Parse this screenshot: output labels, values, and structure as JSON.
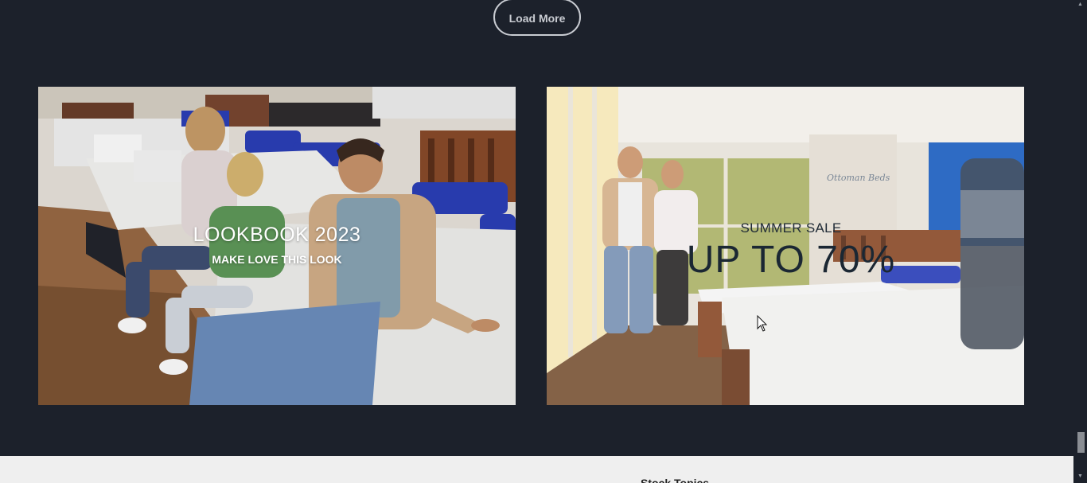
{
  "load_more": {
    "label": "Load More"
  },
  "banners": {
    "lookbook": {
      "title": "LOOKBOOK 2023",
      "subtitle": "MAKE LOVE THIS LOOK"
    },
    "sale": {
      "title": "SUMMER SALE",
      "headline": "UP TO 70%",
      "store_sign": "Ottoman Beds"
    }
  },
  "footer": {
    "partial_heading": "Stock Topics"
  },
  "icons": {
    "cursor": "pointer-cursor-icon",
    "scroll_up": "scroll-up-arrow-icon",
    "scroll_down": "scroll-down-arrow-icon"
  },
  "colors": {
    "page_bg": "#1c212b",
    "button_border": "#c9ccd2",
    "footer_bg": "#efefef",
    "bedding_blue": "#2b3fb8"
  }
}
